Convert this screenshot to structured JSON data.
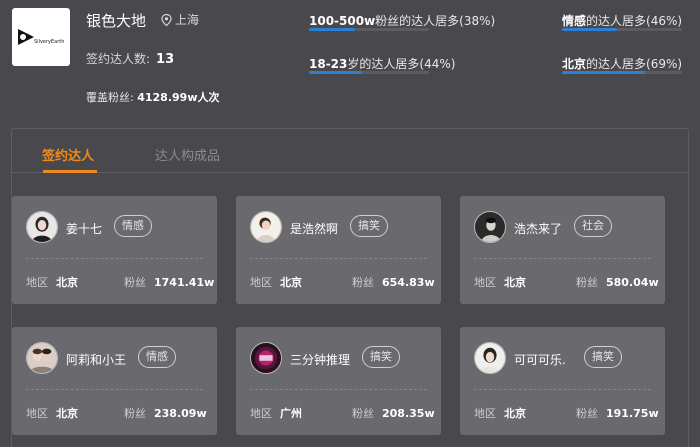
{
  "agency": {
    "logo_text": "SilveryEarth",
    "name": "银色大地",
    "location": "上海",
    "signed_label": "签约达人数:",
    "signed_count": "13",
    "fans_label": "覆盖粉丝:",
    "fans_value": "4128.99w人次"
  },
  "highlights": [
    {
      "strong": "100-500w",
      "rest": "粉丝的达人居多(38%)",
      "percent": 38
    },
    {
      "strong": "情感",
      "rest": "的达人居多(46%)",
      "percent": 46
    },
    {
      "strong": "18-23",
      "rest": "岁的达人居多(44%)",
      "percent": 44
    },
    {
      "strong": "北京",
      "rest": "的达人居多(69%)",
      "percent": 69
    }
  ],
  "tabs": {
    "signed": "签约达人",
    "composition": "达人构成品"
  },
  "labels": {
    "region": "地区",
    "fans": "粉丝"
  },
  "kols": [
    {
      "name": "姜十七",
      "category": "情感",
      "region": "北京",
      "fans": "1741.41w"
    },
    {
      "name": "是浩然啊",
      "category": "搞笑",
      "region": "北京",
      "fans": "654.83w"
    },
    {
      "name": "浩杰来了",
      "category": "社会",
      "region": "北京",
      "fans": "580.04w"
    },
    {
      "name": "阿莉和小王",
      "category": "情感",
      "region": "北京",
      "fans": "238.09w"
    },
    {
      "name": "三分钟推理",
      "category": "搞笑",
      "region": "广州",
      "fans": "208.35w"
    },
    {
      "name": "可可可乐.",
      "category": "搞笑",
      "region": "北京",
      "fans": "191.75w"
    }
  ],
  "colors": {
    "active_tab": "#f08a1c",
    "progress": "#2d7fd3",
    "background": "#49494d",
    "card": "#69696e"
  }
}
